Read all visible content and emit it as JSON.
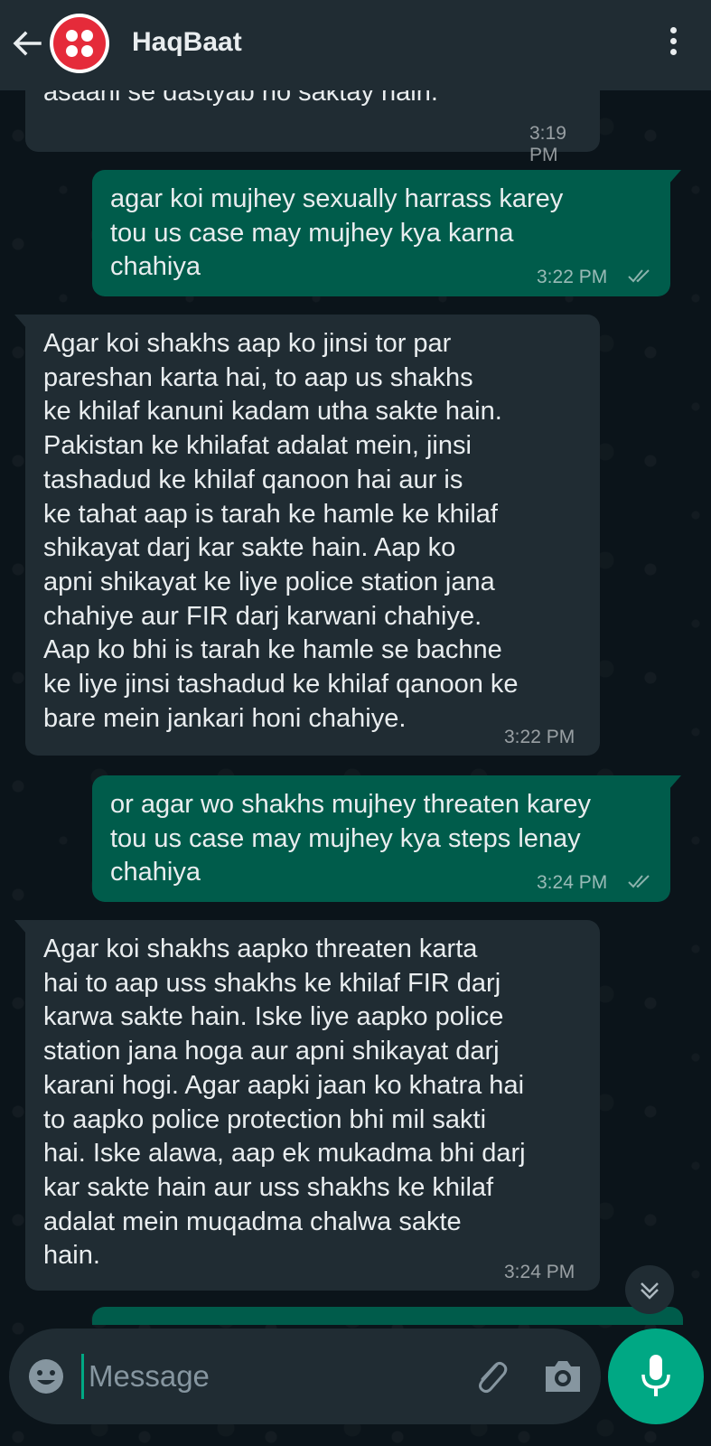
{
  "header": {
    "title": "HaqBaat"
  },
  "messages": [
    {
      "dir": "in",
      "text": "asaani se dastyab ho saktay hain.",
      "time": "3:19 PM"
    },
    {
      "dir": "out",
      "text": "agar koi mujhey sexually harrass karey\ntou us case may mujhey kya karna\nchahiya",
      "time": "3:22 PM",
      "status": "read"
    },
    {
      "dir": "in",
      "text": "Agar koi shakhs aap ko jinsi tor par\npareshan karta hai, to aap us shakhs\nke khilaf kanuni kadam utha sakte hain.\nPakistan ke khilafat adalat mein, jinsi\ntashadud ke khilaf qanoon hai aur is\nke tahat aap is tarah ke hamle ke khilaf\nshikayat darj kar sakte hain. Aap ko\napni shikayat ke liye police station jana\nchahiye aur FIR darj karwani chahiye.\nAap ko bhi is tarah ke hamle se bachne\nke liye jinsi tashadud ke khilaf qanoon ke\nbare mein jankari honi chahiye.",
      "time": "3:22 PM"
    },
    {
      "dir": "out",
      "text": "or agar wo shakhs mujhey threaten karey\ntou us case may mujhey kya steps lenay\nchahiya",
      "time": "3:24 PM",
      "status": "read"
    },
    {
      "dir": "in",
      "text": "Agar koi shakhs aapko threaten karta\nhai to aap uss shakhs ke khilaf FIR darj\nkarwa sakte hain. Iske liye aapko police\nstation jana hoga aur apni shikayat darj\nkarani hogi. Agar aapki jaan ko khatra hai\nto aapko police protection bhi mil sakti\nhai. Iske alawa, aap ek mukadma bhi darj\nkar sakte hain aur uss shakhs ke khilaf\nadalat mein muqadma chalwa sakte\nhain.",
      "time": "3:24 PM"
    }
  ],
  "composer": {
    "placeholder": "Message"
  },
  "colors": {
    "header_bg": "#202c33",
    "incoming_bubble": "#202c33",
    "outgoing_bubble": "#005c4b",
    "accent": "#00a884",
    "chat_bg": "#0b141a"
  },
  "icons": [
    "back-arrow-icon",
    "menu-dots-icon",
    "double-check-icon",
    "chevron-down-icon",
    "emoji-icon",
    "attach-icon",
    "camera-icon",
    "mic-icon"
  ]
}
